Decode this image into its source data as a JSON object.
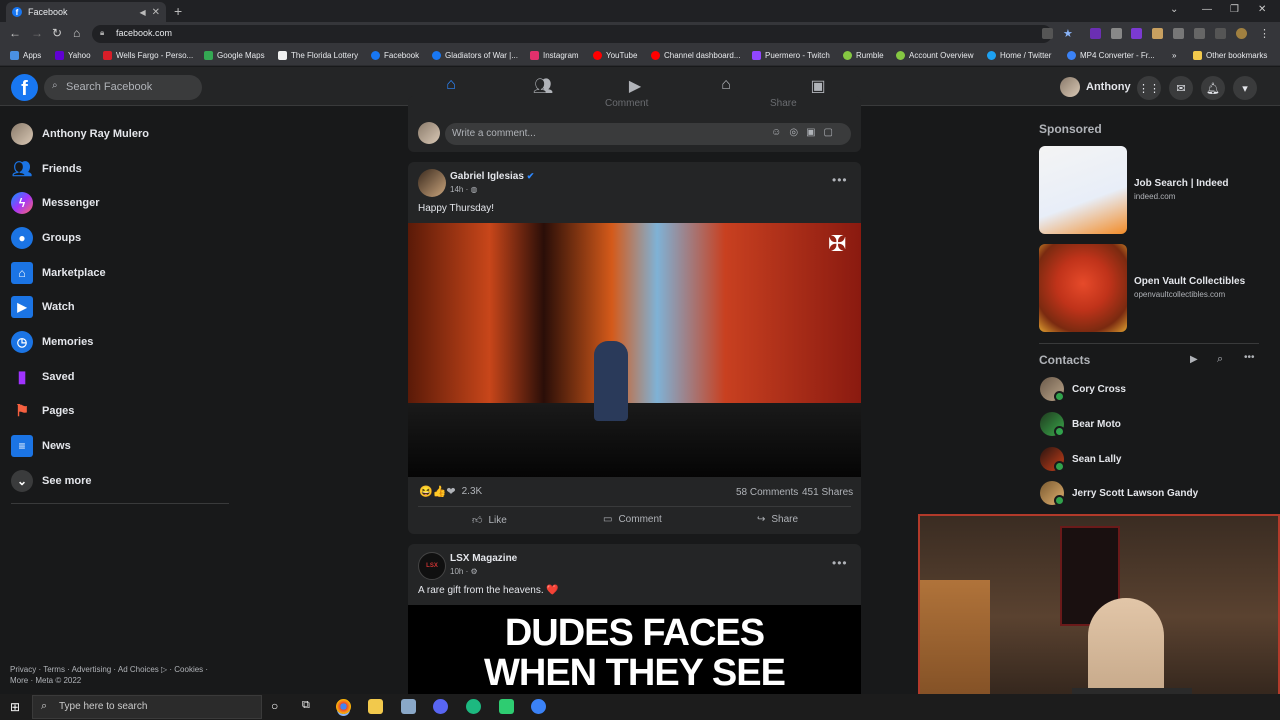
{
  "browser": {
    "tab_title": "Facebook",
    "url": "facebook.com",
    "bookmarks": [
      "Apps",
      "Yahoo",
      "Wells Fargo - Perso...",
      "Google Maps",
      "The Florida Lottery",
      "Facebook",
      "Gladiators of War |...",
      "Instagram",
      "YouTube",
      "Channel dashboard...",
      "Puermero - Twitch",
      "Rumble",
      "Account Overview",
      "Home / Twitter",
      "MP4 Converter - Fr...",
      "Other bookmarks"
    ]
  },
  "header": {
    "search_placeholder": "Search Facebook",
    "profile_name": "Anthony"
  },
  "sidebar": {
    "items": [
      {
        "label": "Anthony Ray Mulero",
        "icon": "profile-avatar"
      },
      {
        "label": "Friends",
        "icon": "friends-icon"
      },
      {
        "label": "Messenger",
        "icon": "messenger-icon"
      },
      {
        "label": "Groups",
        "icon": "groups-icon"
      },
      {
        "label": "Marketplace",
        "icon": "marketplace-icon"
      },
      {
        "label": "Watch",
        "icon": "watch-icon"
      },
      {
        "label": "Memories",
        "icon": "memories-icon"
      },
      {
        "label": "Saved",
        "icon": "saved-icon"
      },
      {
        "label": "Pages",
        "icon": "pages-icon"
      },
      {
        "label": "News",
        "icon": "news-icon"
      },
      {
        "label": "See more",
        "icon": "chevron-down-icon"
      }
    ],
    "footer_line1": "Privacy · Terms · Advertising · Ad Choices ▷ · Cookies ·",
    "footer_line2": "More · Meta © 2022"
  },
  "feed": {
    "comment_placeholder": "Write a comment...",
    "partial_actions": {
      "comment": "Comment",
      "share": "Share"
    },
    "post1": {
      "author": "Gabriel Iglesias",
      "time": "14h",
      "text": "Happy Thursday!",
      "reactions": "2.3K",
      "comments": "58 Comments",
      "shares": "451 Shares",
      "like": "Like",
      "comment": "Comment",
      "share": "Share"
    },
    "post2": {
      "author": "LSX Magazine",
      "time": "10h",
      "text": "A rare gift from the heavens. ❤️",
      "image_caption_line1": "DUDES FACES",
      "image_caption_line2": "WHEN THEY SEE"
    }
  },
  "right": {
    "sponsored_label": "Sponsored",
    "ads": [
      {
        "title": "Job Search | Indeed",
        "url": "indeed.com"
      },
      {
        "title": "Open Vault Collectibles",
        "url": "openvaultcollectibles.com"
      }
    ],
    "contacts_label": "Contacts",
    "contacts": [
      "Cory Cross",
      "Bear Moto",
      "Sean Lally",
      "Jerry Scott Lawson Gandy"
    ]
  },
  "taskbar": {
    "search_placeholder": "Type here to search"
  },
  "colors": {
    "accent": "#2d88ff",
    "fb_blue": "#1877f2",
    "bg": "#18191a",
    "card": "#242526",
    "online": "#31a24c"
  }
}
